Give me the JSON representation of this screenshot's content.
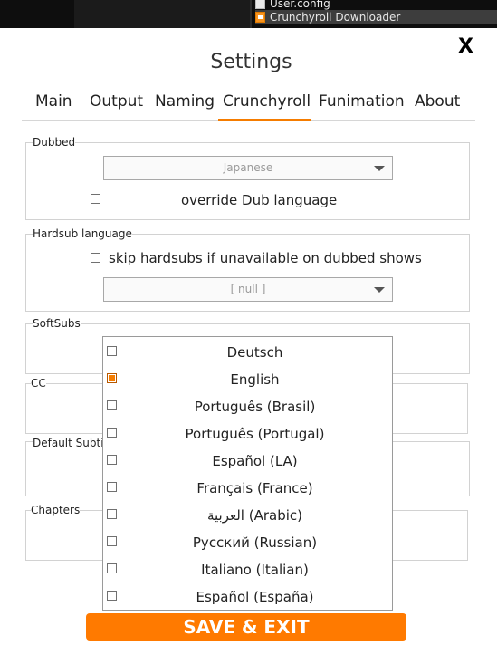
{
  "background_window": {
    "items": [
      "User.config",
      "Crunchyroll Downloader"
    ]
  },
  "dialog": {
    "title": "Settings",
    "close_label": "X",
    "accent_color": "#f57c00"
  },
  "tabs": [
    {
      "label": "Main"
    },
    {
      "label": "Output"
    },
    {
      "label": "Naming"
    },
    {
      "label": "Crunchyroll",
      "active": true
    },
    {
      "label": "Funimation"
    },
    {
      "label": "About"
    }
  ],
  "dubbed": {
    "label": "Dubbed",
    "selected": "Japanese",
    "override_label": "override Dub language",
    "override_checked": false
  },
  "hardsub": {
    "label": "Hardsub language",
    "skip_label": "skip hardsubs if unavailable on dubbed shows",
    "skip_checked": false,
    "selected": "[ null ]"
  },
  "softsubs": {
    "label": "SoftSubs",
    "options": [
      {
        "label": "Deutsch",
        "checked": false
      },
      {
        "label": "English",
        "checked": true
      },
      {
        "label": "Português (Brasil)",
        "checked": false
      },
      {
        "label": "Português (Portugal)",
        "checked": false
      },
      {
        "label": "Español (LA)",
        "checked": false
      },
      {
        "label": "Français (France)",
        "checked": false
      },
      {
        "label": "العربية (Arabic)",
        "checked": false
      },
      {
        "label": "Русский (Russian)",
        "checked": false
      },
      {
        "label": "Italiano (Italian)",
        "checked": false
      },
      {
        "label": "Español (España)",
        "checked": false
      }
    ]
  },
  "cc": {
    "label": "CC"
  },
  "default_subtitle": {
    "label": "Default Subtit"
  },
  "chapters": {
    "label": "Chapters"
  },
  "save_button": {
    "label": "SAVE & EXIT"
  }
}
